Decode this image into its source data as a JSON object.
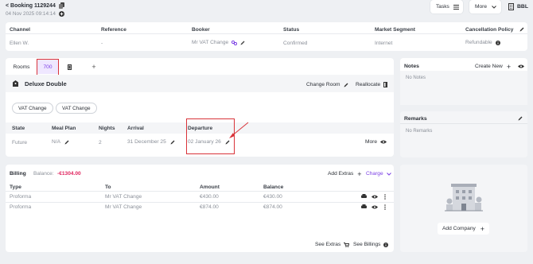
{
  "header": {
    "back_label": "< Booking 1129244",
    "datetime": "04 Nov 2025 09:14:14",
    "tasks_label": "Tasks",
    "more_label": "More",
    "currency": "BBL"
  },
  "booking_info": {
    "columns": [
      "Channel",
      "Reference",
      "Booker",
      "Status",
      "Market Segment",
      "Cancellation Policy"
    ],
    "values": {
      "channel": "Ellen W.",
      "reference": "-",
      "booker": "Mr VAT Change",
      "status": "Confirmed",
      "market_segment": "Internet",
      "cancellation_policy": "Refundable"
    }
  },
  "rooms": {
    "tab_rooms": "Rooms",
    "tab_room_number": "700",
    "tab_add": "+",
    "room_type": "Deluxe Double",
    "change_room_label": "Change Room",
    "reallocate_label": "Reallocate",
    "guest_pills": [
      "VAT Change",
      "VAT Change"
    ],
    "table_headers": [
      "State",
      "Meal Plan",
      "Nights",
      "Arrival",
      "Departure"
    ],
    "row": {
      "state": "Future",
      "meal_plan": "N/A",
      "nights": "2",
      "arrival": "31 December 25",
      "departure": "02 January 26",
      "more_label": "More"
    }
  },
  "billing": {
    "title": "Billing",
    "balance_label": "Balance:",
    "balance_value": "-€1304.00",
    "add_extras_label": "Add Extras",
    "charge_label": "Charge",
    "headers": [
      "Type",
      "To",
      "Amount",
      "Balance"
    ],
    "rows": [
      {
        "type": "Proforma",
        "to": "Mr VAT Change",
        "amount": "€430.00",
        "balance": "€430.00"
      },
      {
        "type": "Proforma",
        "to": "Mr VAT Change",
        "amount": "€874.00",
        "balance": "€874.00"
      }
    ],
    "see_extras_label": "See Extras",
    "see_billings_label": "See Billings"
  },
  "notes": {
    "title": "Notes",
    "create_new_label": "Create New",
    "empty_text": "No Notes"
  },
  "remarks": {
    "title": "Remarks",
    "empty_text": "No Remarks"
  },
  "company": {
    "add_company_label": "Add Company"
  },
  "colors": {
    "accent_purple": "#7b3fe4",
    "balance_red": "#e0245e",
    "highlight_red": "#d9343a"
  }
}
